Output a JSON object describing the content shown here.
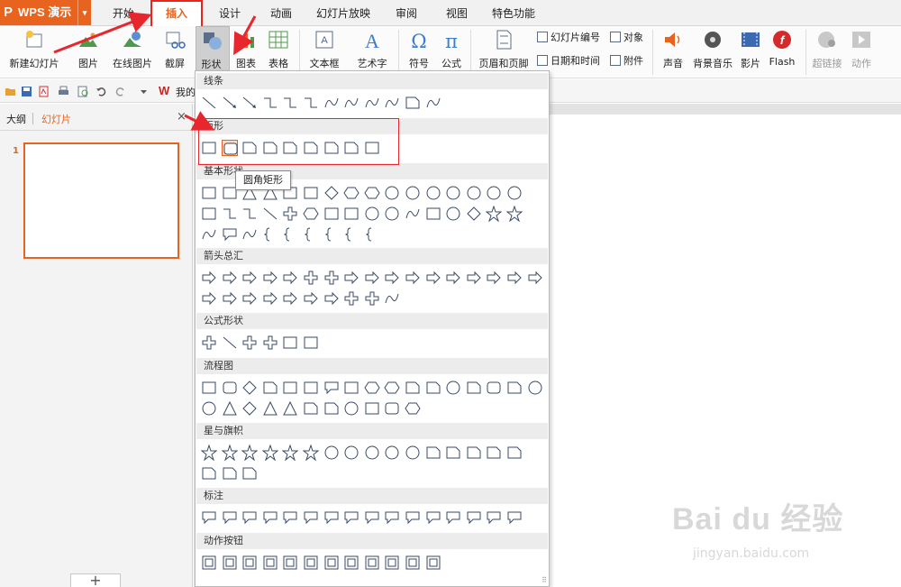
{
  "app": {
    "logo_p": "P",
    "logo_text": "WPS 演示",
    "logo_arrow": "▾",
    "brand_color": "#e8641e"
  },
  "tabs": [
    "开始",
    "插入",
    "设计",
    "动画",
    "幻灯片放映",
    "审阅",
    "视图",
    "特色功能"
  ],
  "active_tab": "插入",
  "ribbon": {
    "new_slide": "新建幻灯片",
    "picture": "图片",
    "online_picture": "在线图片",
    "screenshot": "截屏",
    "shape": "形状",
    "chart": "图表",
    "table": "表格",
    "textbox": "文本框",
    "wordart": "艺术字",
    "symbol": "符号",
    "equation": "公式",
    "header_footer": "页眉和页脚",
    "slide_number": "幻灯片编号",
    "object": "对象",
    "date_time": "日期和时间",
    "attachment": "附件",
    "sound": "声音",
    "bg_music": "背景音乐",
    "movie": "影片",
    "flash": "Flash",
    "hyperlink": "超链接",
    "action": "动作"
  },
  "quick_access": {
    "wps_letter": "W",
    "wps_label": "我的"
  },
  "left_panel": {
    "outline_tab": "大纲",
    "slides_tab": "幻灯片",
    "close": "×",
    "slide_number": "1",
    "add": "+"
  },
  "gallery": {
    "categories": [
      "线条",
      "矩形",
      "基本形状",
      "箭头总汇",
      "公式形状",
      "流程图",
      "星与旗帜",
      "标注",
      "动作按钮"
    ],
    "tooltip": "圆角矩形",
    "grip": "⠿"
  },
  "watermark": {
    "main": "Bai du 经验",
    "sub": "jingyan.baidu.com"
  }
}
